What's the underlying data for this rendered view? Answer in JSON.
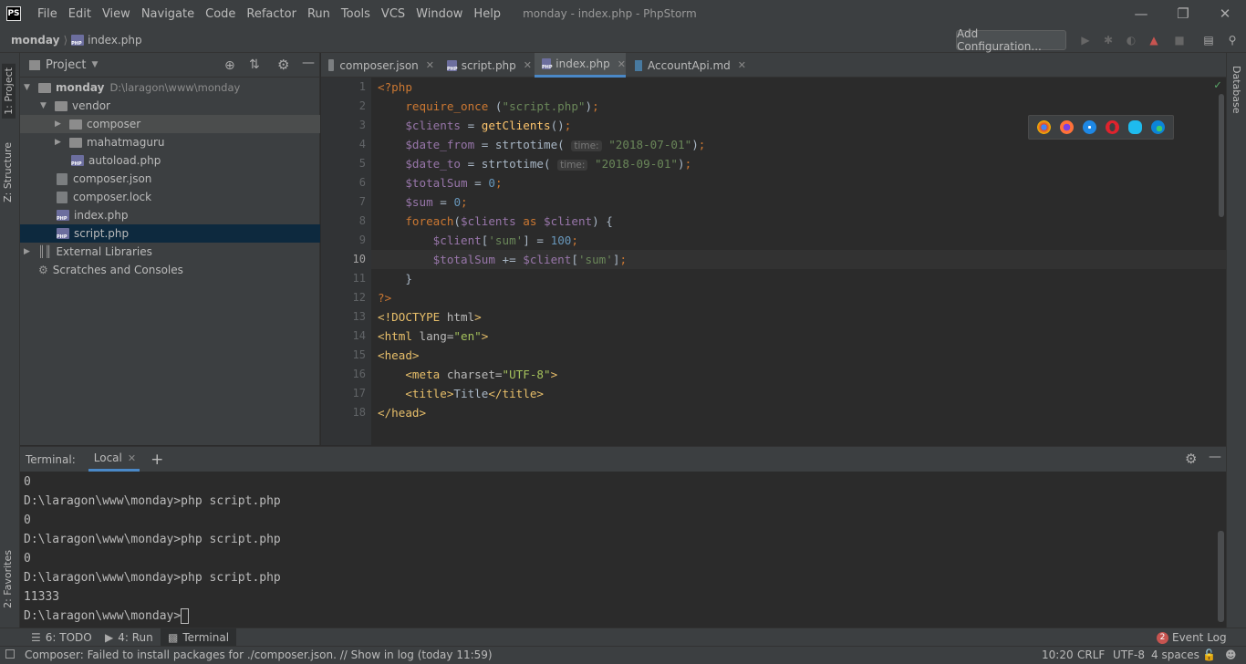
{
  "window": {
    "title": "monday - index.php - PhpStorm",
    "logo": "PS"
  },
  "menu": [
    "File",
    "Edit",
    "View",
    "Navigate",
    "Code",
    "Refactor",
    "Run",
    "Tools",
    "VCS",
    "Window",
    "Help"
  ],
  "navbar": {
    "project": "monday",
    "file": "index.php",
    "add_config": "Add Configuration..."
  },
  "left_strip": {
    "project": "1: Project",
    "structure": "Z: Structure",
    "favorites": "2: Favorites"
  },
  "right_strip": {
    "database": "Database"
  },
  "project_panel": {
    "title": "Project",
    "tree": [
      {
        "label": "monday",
        "path": "D:\\laragon\\www\\monday"
      },
      {
        "label": "vendor"
      },
      {
        "label": "composer"
      },
      {
        "label": "mahatmaguru"
      },
      {
        "label": "autoload.php"
      },
      {
        "label": "composer.json"
      },
      {
        "label": "composer.lock"
      },
      {
        "label": "index.php"
      },
      {
        "label": "script.php"
      },
      {
        "label": "External Libraries"
      },
      {
        "label": "Scratches and Consoles"
      }
    ]
  },
  "tabs": [
    "composer.json",
    "script.php",
    "index.php",
    "AccountApi.md"
  ],
  "editor": {
    "line_numbers": [
      "1",
      "2",
      "3",
      "4",
      "5",
      "6",
      "7",
      "8",
      "9",
      "10",
      "11",
      "12",
      "13",
      "14",
      "15",
      "16",
      "17",
      "18"
    ],
    "hint_time": "time:"
  },
  "terminal": {
    "label": "Terminal:",
    "tab": "Local",
    "lines": [
      "0",
      "D:\\laragon\\www\\monday>php script.php",
      "0",
      "D:\\laragon\\www\\monday>php script.php",
      "0",
      "D:\\laragon\\www\\monday>php script.php",
      "11333",
      "D:\\laragon\\www\\monday>"
    ]
  },
  "toolwindows": {
    "todo": "6: TODO",
    "run": "4: Run",
    "terminal": "Terminal",
    "event_log": "Event Log",
    "event_count": "2"
  },
  "status": {
    "message": "Composer: Failed to install packages for  ./composer.json. // Show in log (today 11:59)",
    "position": "10:20",
    "line_sep": "CRLF",
    "encoding": "UTF-8",
    "indent": "4 spaces"
  },
  "colors": {
    "accent": "#4a88c7",
    "background": "#2b2b2b",
    "panel": "#3c3f41",
    "selection": "#0d293e"
  }
}
